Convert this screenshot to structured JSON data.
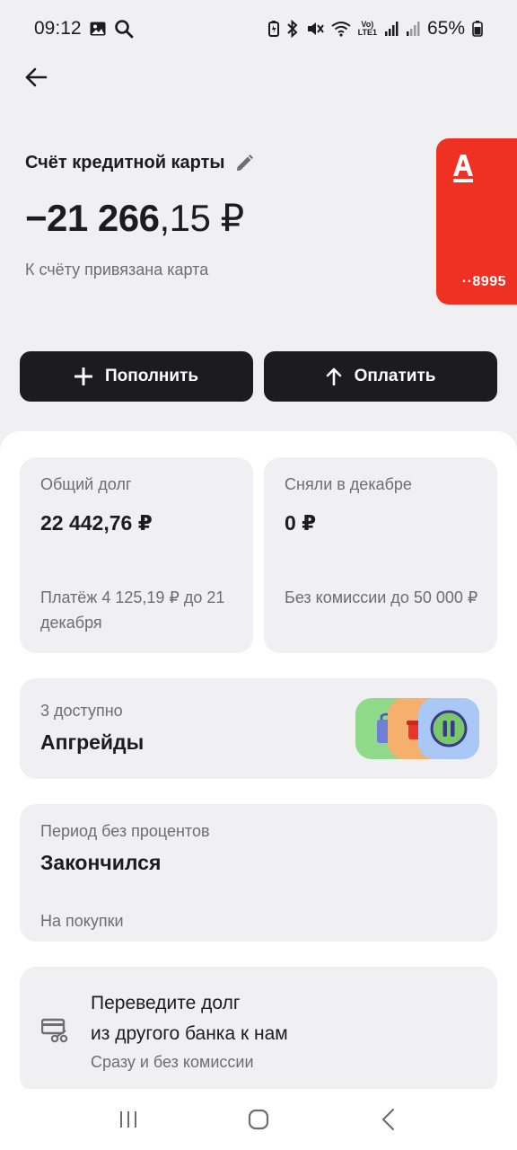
{
  "status_bar": {
    "time": "09:12",
    "battery_percent": "65%",
    "left_icons": [
      "image-icon",
      "search-icon"
    ],
    "right_icons": [
      "battery-saver-icon",
      "bluetooth-icon",
      "mute-icon",
      "wifi-icon",
      "volte-icon",
      "signal-icon",
      "signal-icon",
      "battery-icon"
    ],
    "volte_text": "Vo)\nLTE1"
  },
  "header": {
    "account_title": "Счёт кредитной карты",
    "balance_int": "−21 266",
    "balance_frac": ",15 ₽",
    "linked_text": "К счёту привязана карта"
  },
  "card": {
    "logo": "А",
    "digits": "··8995",
    "color": "#ef3124"
  },
  "actions": {
    "topup_label": "Пополнить",
    "pay_label": "Оплатить"
  },
  "debt": {
    "label": "Общий долг",
    "value": "22 442,76 ₽",
    "note": "Платёж 4 125,19 ₽ до 21 декабря"
  },
  "spent": {
    "label": "Сняли в декабре",
    "value": "0 ₽",
    "note": "Без комиссии до 50 000 ₽"
  },
  "upgrades": {
    "label": "3 доступно",
    "title": "Апгрейды"
  },
  "grace": {
    "label": "Период без процентов",
    "value": "Закончился",
    "note": "На покупки"
  },
  "transfer": {
    "title_line1": "Переведите долг",
    "title_line2": "из другого банка к нам",
    "subtitle": "Сразу и без комиссии"
  },
  "colors": {
    "background": "#f0f0f2",
    "sheet": "#ffffff",
    "button": "#1c1c1e",
    "accent_red": "#ef3124"
  }
}
